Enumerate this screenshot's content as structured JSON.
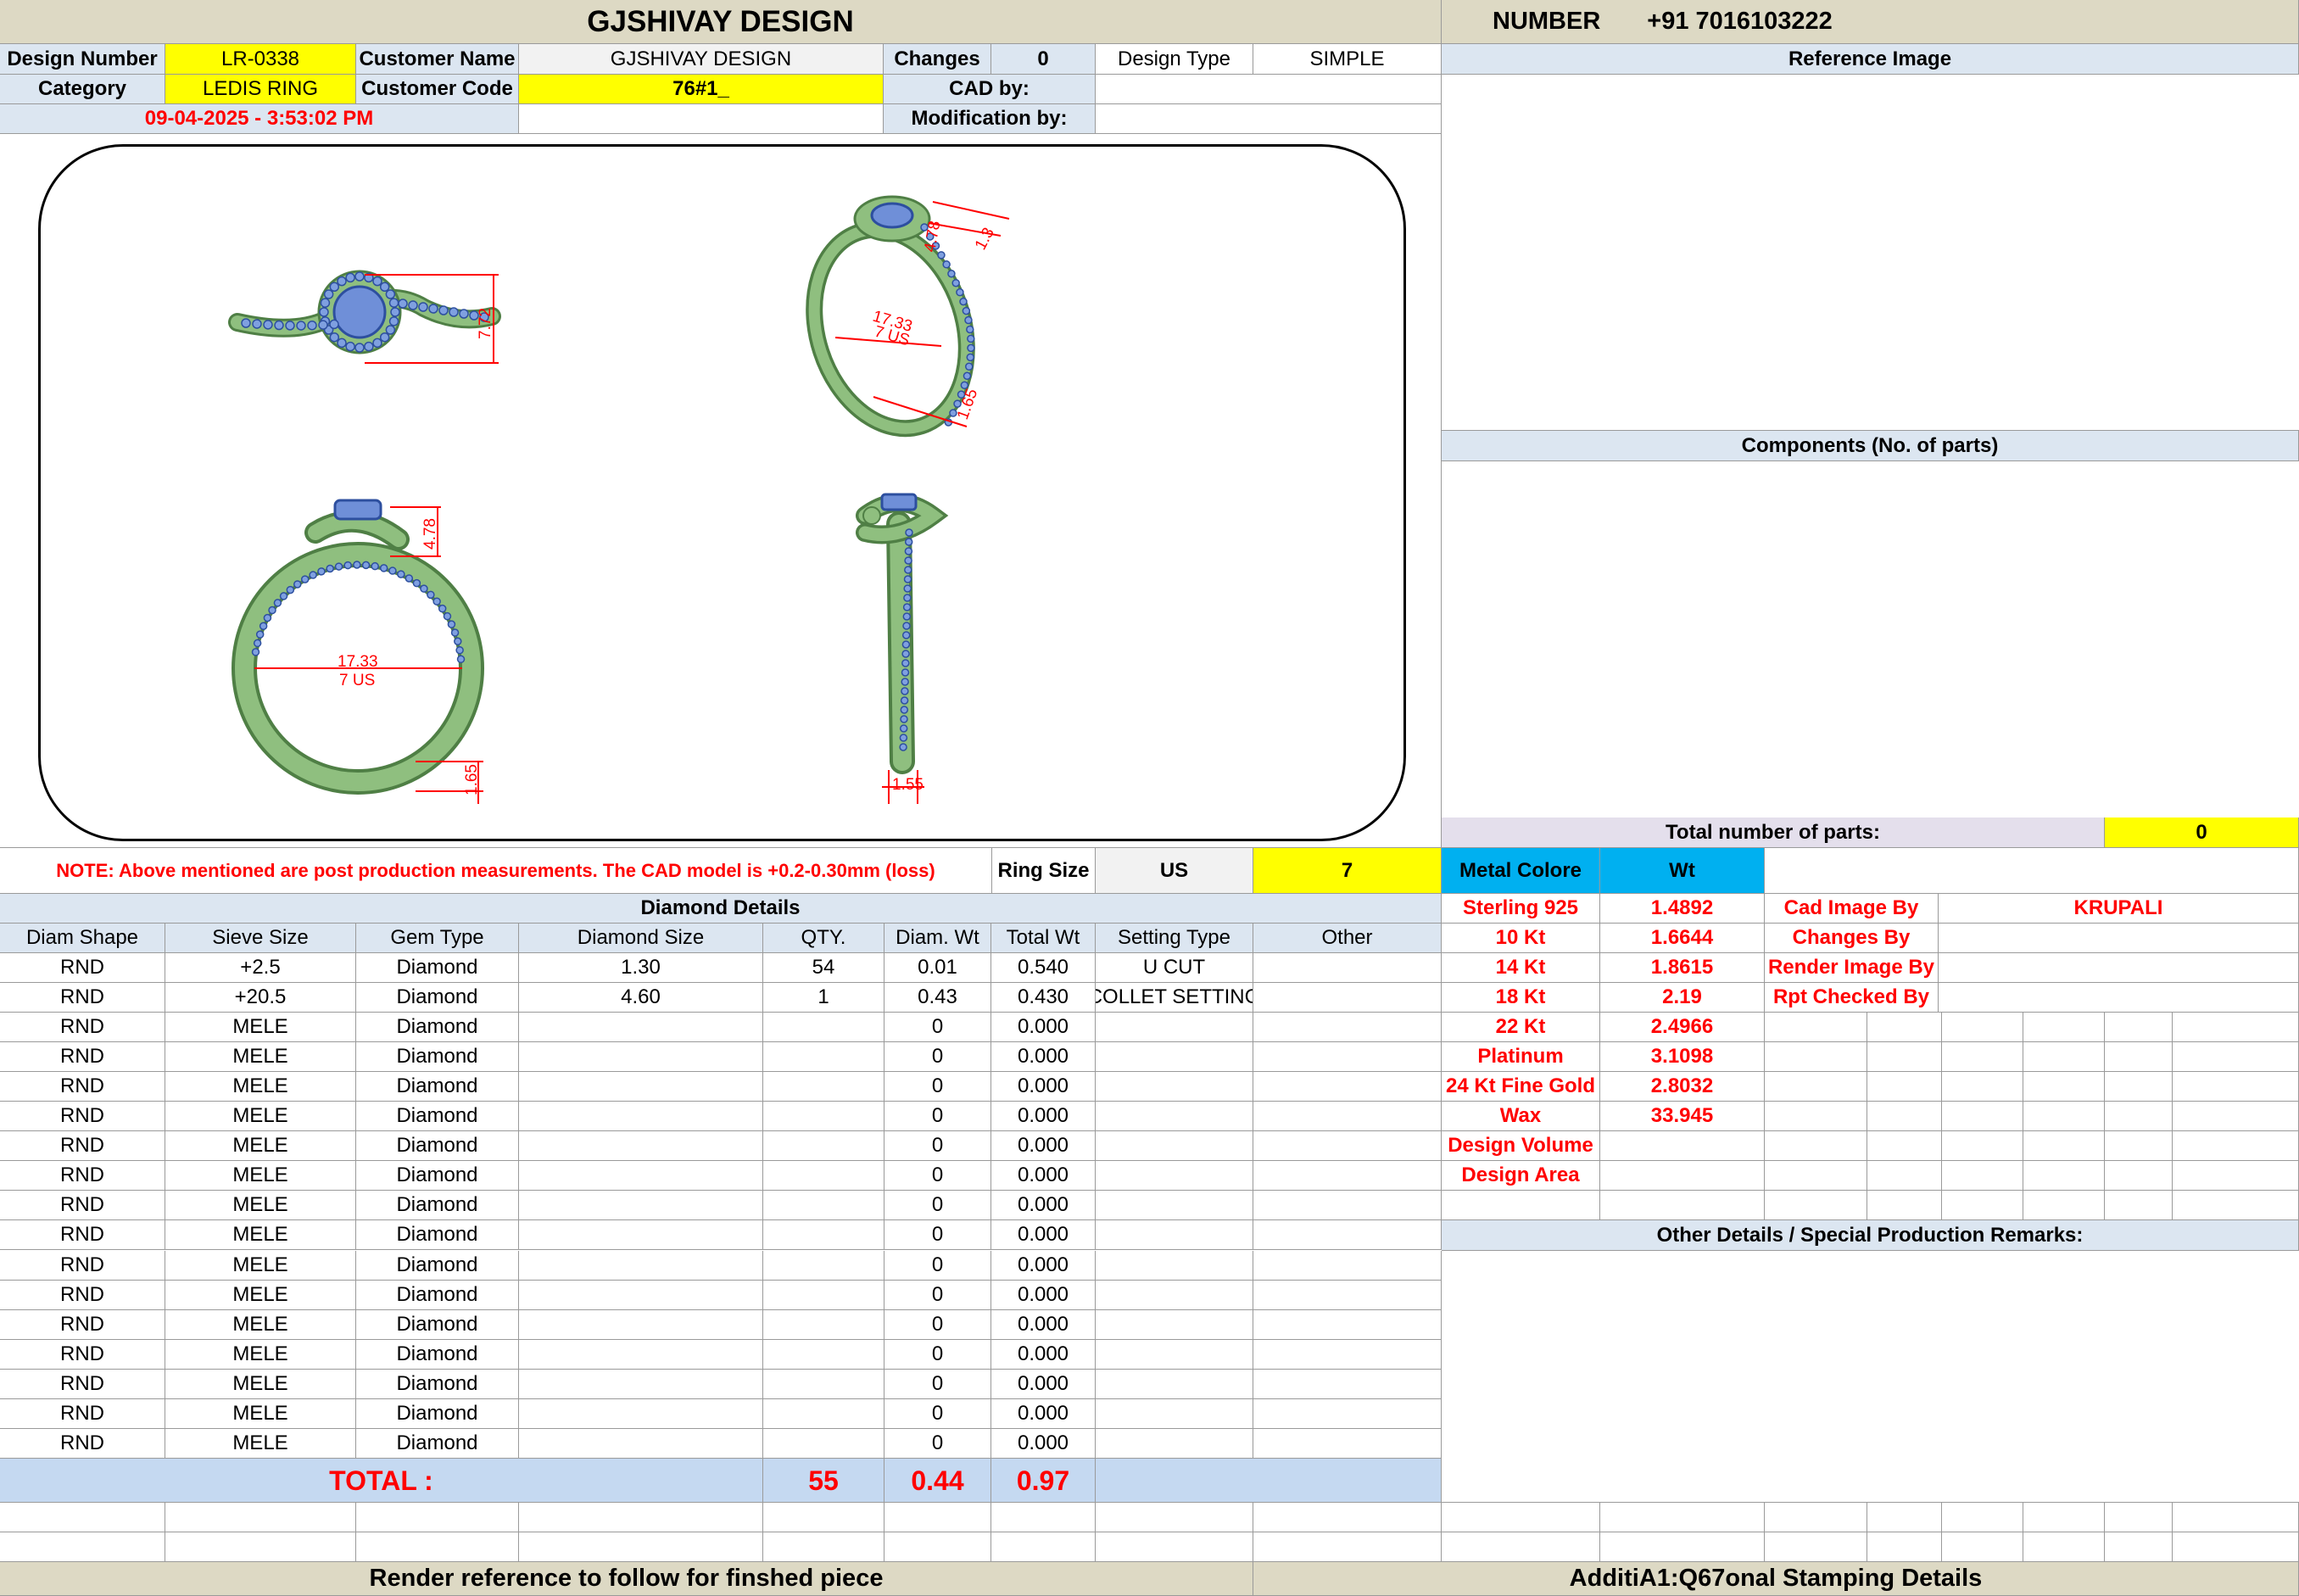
{
  "header": {
    "title": "GJSHIVAY DESIGN",
    "number_label": "NUMBER",
    "number_value": "+91 7016103222"
  },
  "info": {
    "design_number_label": "Design Number",
    "design_number": "LR-0338",
    "customer_name_label": "Customer Name",
    "customer_name": "GJSHIVAY DESIGN",
    "changes_label": "Changes",
    "changes": "0",
    "design_type_label": "Design Type",
    "design_type": "SIMPLE",
    "category_label": "Category",
    "category": "LEDIS RING",
    "customer_code_label": "Customer Code",
    "customer_code": "76#1_",
    "cad_by_label": "CAD by:",
    "cad_by": "",
    "datetime": "09-04-2025 - 3:53:02 PM",
    "modification_by_label": "Modification by:",
    "modification_by": ""
  },
  "reference": {
    "label": "Reference Image"
  },
  "components": {
    "label": "Components (No. of parts)",
    "total_label": "Total number of parts:",
    "total": "0"
  },
  "drawing": {
    "top_dim": "7.72",
    "persp_dim_a": "4.78",
    "persp_dim_b": "1.3",
    "persp_ring_size": "17.33",
    "persp_ring_us": "7 US",
    "persp_dim_c": "1.65",
    "front_dim_top": "4.78",
    "front_ring_size": "17.33",
    "front_ring_us": "7 US",
    "front_dim_bottom": "1.65",
    "side_dim": "1.55"
  },
  "note": {
    "text": "NOTE: Above mentioned are post production measurements. The CAD model is +0.2-0.30mm (loss)",
    "ring_size_label": "Ring Size",
    "ring_size_unit": "US",
    "ring_size": "7"
  },
  "diamond": {
    "title": "Diamond Details",
    "headers": [
      "Diam Shape",
      "Sieve Size",
      "Gem Type",
      "Diamond Size",
      "QTY.",
      "Diam. Wt",
      "Total Wt",
      "Setting Type",
      "Other"
    ],
    "rows": [
      [
        "RND",
        "+2.5",
        "Diamond",
        "1.30",
        "54",
        "0.01",
        "0.540",
        "U CUT",
        ""
      ],
      [
        "RND",
        "+20.5",
        "Diamond",
        "4.60",
        "1",
        "0.43",
        "0.430",
        "COLLET SETTING",
        ""
      ],
      [
        "RND",
        "MELE",
        "Diamond",
        "",
        "",
        "0",
        "0.000",
        "",
        ""
      ],
      [
        "RND",
        "MELE",
        "Diamond",
        "",
        "",
        "0",
        "0.000",
        "",
        ""
      ],
      [
        "RND",
        "MELE",
        "Diamond",
        "",
        "",
        "0",
        "0.000",
        "",
        ""
      ],
      [
        "RND",
        "MELE",
        "Diamond",
        "",
        "",
        "0",
        "0.000",
        "",
        ""
      ],
      [
        "RND",
        "MELE",
        "Diamond",
        "",
        "",
        "0",
        "0.000",
        "",
        ""
      ],
      [
        "RND",
        "MELE",
        "Diamond",
        "",
        "",
        "0",
        "0.000",
        "",
        ""
      ],
      [
        "RND",
        "MELE",
        "Diamond",
        "",
        "",
        "0",
        "0.000",
        "",
        ""
      ],
      [
        "RND",
        "MELE",
        "Diamond",
        "",
        "",
        "0",
        "0.000",
        "",
        ""
      ],
      [
        "RND",
        "MELE",
        "Diamond",
        "",
        "",
        "0",
        "0.000",
        "",
        ""
      ],
      [
        "RND",
        "MELE",
        "Diamond",
        "",
        "",
        "0",
        "0.000",
        "",
        ""
      ],
      [
        "RND",
        "MELE",
        "Diamond",
        "",
        "",
        "0",
        "0.000",
        "",
        ""
      ],
      [
        "RND",
        "MELE",
        "Diamond",
        "",
        "",
        "0",
        "0.000",
        "",
        ""
      ],
      [
        "RND",
        "MELE",
        "Diamond",
        "",
        "",
        "0",
        "0.000",
        "",
        ""
      ],
      [
        "RND",
        "MELE",
        "Diamond",
        "",
        "",
        "0",
        "0.000",
        "",
        ""
      ],
      [
        "RND",
        "MELE",
        "Diamond",
        "",
        "",
        "0",
        "0.000",
        "",
        ""
      ]
    ],
    "total_label": "TOTAL :",
    "total_qty": "55",
    "total_diam_wt": "0.44",
    "total_wt": "0.97"
  },
  "metal": {
    "color_label": "Metal Colore",
    "wt_label": "Wt",
    "rows": [
      {
        "name": "Sterling 925",
        "wt": "1.4892"
      },
      {
        "name": "10 Kt",
        "wt": "1.6644"
      },
      {
        "name": "14 Kt",
        "wt": "1.8615"
      },
      {
        "name": "18 Kt",
        "wt": "2.19"
      },
      {
        "name": "22 Kt",
        "wt": "2.4966"
      },
      {
        "name": "Platinum",
        "wt": "3.1098"
      },
      {
        "name": "24 Kt Fine Gold",
        "wt": "2.8032"
      },
      {
        "name": "Wax",
        "wt": "33.945"
      },
      {
        "name": "Design Volume",
        "wt": ""
      },
      {
        "name": "Design Area",
        "wt": ""
      }
    ]
  },
  "credits": [
    {
      "label": "Cad Image By",
      "value": "KRUPALI"
    },
    {
      "label": "Changes By",
      "value": ""
    },
    {
      "label": "Render Image By",
      "value": ""
    },
    {
      "label": "Rpt Checked By",
      "value": ""
    }
  ],
  "other_details": {
    "label": "Other Details / Special Production Remarks:"
  },
  "footer": {
    "render_reference": "Render reference to follow for finshed piece",
    "stamping": "AdditiA1:Q67onal Stamping Details"
  },
  "colors": {
    "yellow": "#ffff00",
    "header_tan": "#ddd9c4",
    "label_blue": "#dce6f1",
    "metal_blue": "#00b0f0",
    "total_blue": "#c5d9f1",
    "red_text": "#ff0000",
    "band_green": "#8fbf7f",
    "gem_blue": "#6f8fd8"
  }
}
